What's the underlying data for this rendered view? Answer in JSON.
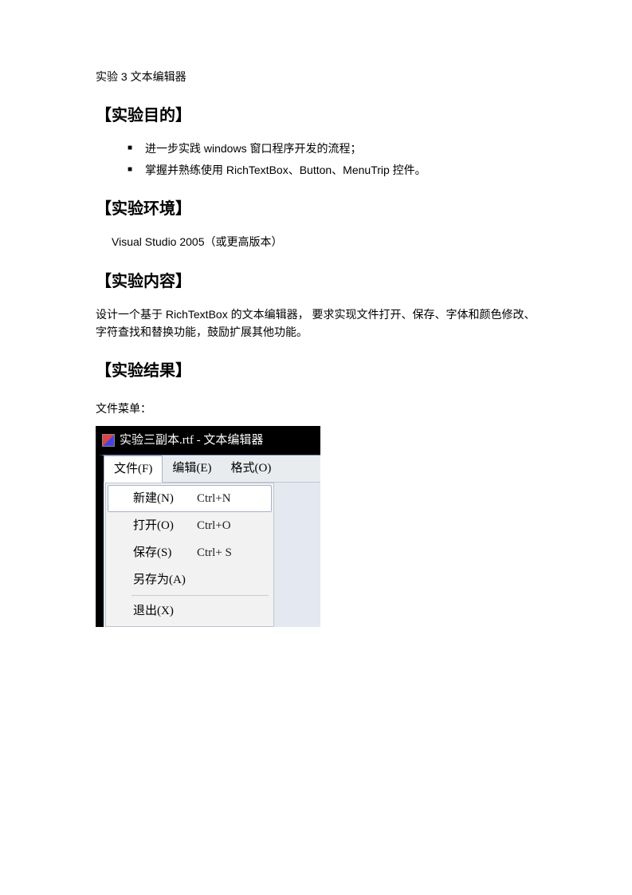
{
  "title3": "实验 3  文本编辑器",
  "h_objective": "【实验目的】",
  "objectives": [
    "进一步实践 windows 窗口程序开发的流程；",
    " 掌握并熟练使用 RichTextBox、Button、MenuTrip 控件。"
  ],
  "h_env": "【实验环境】",
  "env_text": "Visual Studio 2005（或更高版本）",
  "h_content": "【实验内容】",
  "content_text": "设计一个基于 RichTextBox 的文本编辑器， 要求实现文件打开、保存、字体和颜色修改、字符查找和替换功能，鼓励扩展其他功能。",
  "h_result": "【实验结果】",
  "caption_file_menu": "文件菜单：",
  "editor": {
    "window_title": "实验三副本.rtf - 文本编辑器",
    "menus": {
      "file": "文件(F)",
      "edit": "编辑(E)",
      "format": "格式(O)"
    },
    "file_menu": {
      "new": {
        "label": "新建(N)",
        "shortcut": "Ctrl+N"
      },
      "open": {
        "label": "打开(O)",
        "shortcut": "Ctrl+O"
      },
      "save": {
        "label": "保存(S)",
        "shortcut": "Ctrl+ S"
      },
      "saveas": {
        "label": "另存为(A)",
        "shortcut": ""
      },
      "exit": {
        "label": "退出(X)",
        "shortcut": ""
      }
    }
  }
}
